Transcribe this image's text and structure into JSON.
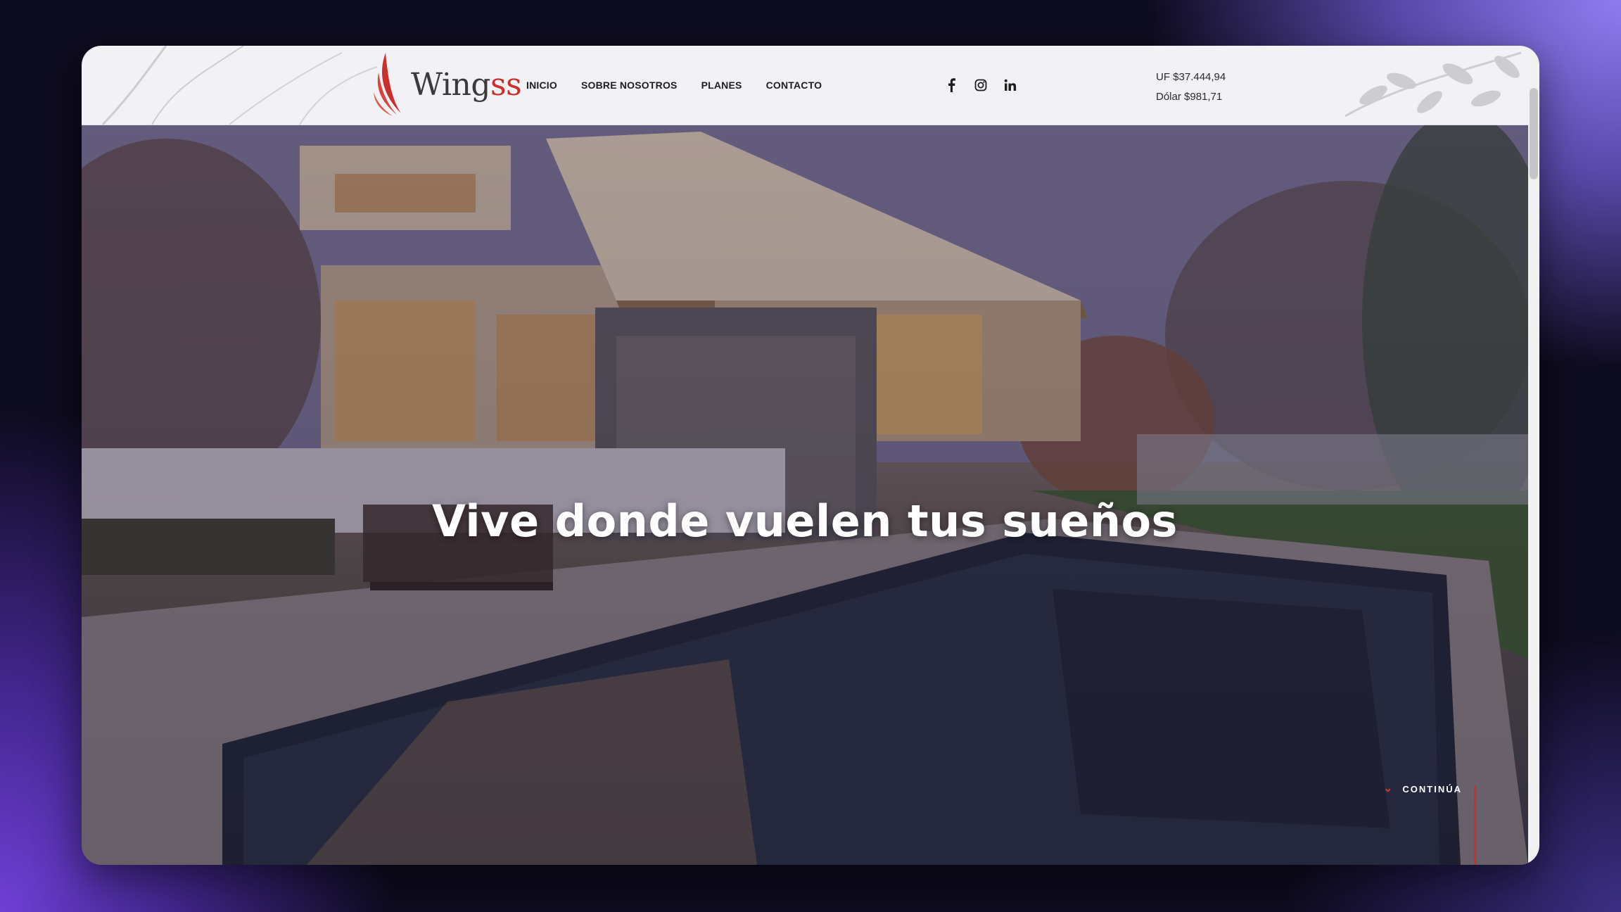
{
  "brand": {
    "name_main": "Wing",
    "name_accent": "ss",
    "accent_color": "#c9302c"
  },
  "nav": {
    "items": [
      {
        "label": "INICIO"
      },
      {
        "label": "SOBRE NOSOTROS"
      },
      {
        "label": "PLANES"
      },
      {
        "label": "CONTACTO"
      }
    ]
  },
  "social": {
    "icons": [
      "facebook-icon",
      "instagram-icon",
      "linkedin-icon"
    ]
  },
  "rates": {
    "uf": "UF $37.444,94",
    "dolar": "Dólar $981,71"
  },
  "hero": {
    "headline": "Vive donde vuelen tus sueños",
    "continue_label": "CONTINÚA"
  }
}
